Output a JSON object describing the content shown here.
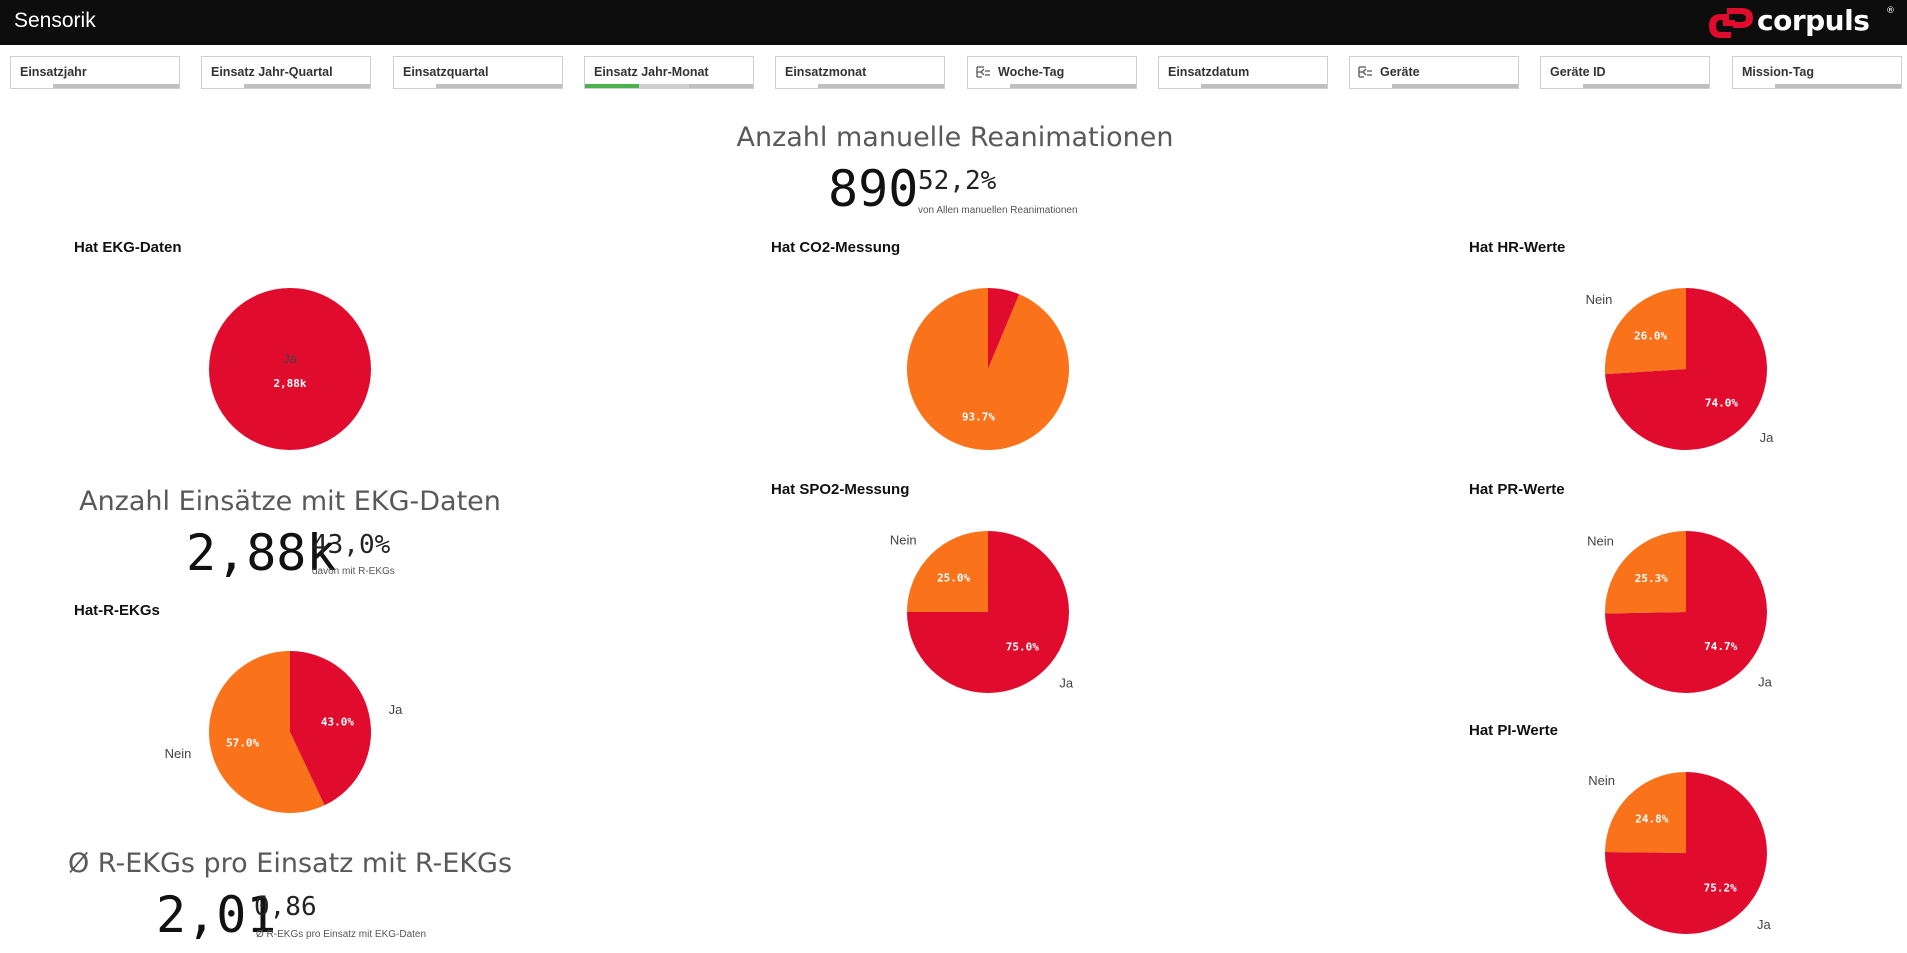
{
  "app": {
    "title": "Sensorik",
    "logo_text": "corpuls",
    "logo_mark": "®"
  },
  "colors": {
    "red": "#e00b2d",
    "orange": "#fa7219",
    "green": "#4caf50",
    "gray_bar": "#bfbfbf",
    "light_bar": "#d0d0d0"
  },
  "filters": [
    {
      "label": "Einsatzjahr",
      "icon": "",
      "selection": {
        "green": 0,
        "light": 0
      }
    },
    {
      "label": "Einsatz Jahr-Quartal",
      "icon": "",
      "selection": {
        "green": 0,
        "light": 0
      }
    },
    {
      "label": "Einsatzquartal",
      "icon": "",
      "selection": {
        "green": 0,
        "light": 0
      }
    },
    {
      "label": "Einsatz Jahr-Monat",
      "icon": "",
      "selection": {
        "green": 0.32,
        "light": 0.3
      }
    },
    {
      "label": "Einsatzmonat",
      "icon": "",
      "selection": {
        "green": 0,
        "light": 0
      }
    },
    {
      "label": "Woche-Tag",
      "icon": "hierarchy-icon",
      "selection": {
        "green": 0,
        "light": 0
      }
    },
    {
      "label": "Einsatzdatum",
      "icon": "",
      "selection": {
        "green": 0,
        "light": 0
      }
    },
    {
      "label": "Geräte",
      "icon": "hierarchy-icon",
      "selection": {
        "green": 0,
        "light": 0
      }
    },
    {
      "label": "Geräte ID",
      "icon": "",
      "selection": {
        "green": 0,
        "light": 0
      }
    },
    {
      "label": "Mission-Tag",
      "icon": "",
      "selection": {
        "green": 0,
        "light": 0
      }
    }
  ],
  "kpis": {
    "reanimationen": {
      "title": "Anzahl manuelle Reanimationen",
      "value": "890",
      "sub_value": "52,2%",
      "note": "von Allen manuellen Reanimationen"
    },
    "ekg_einsaetze": {
      "title": "Anzahl Einsätze mit EKG-Daten",
      "value": "2,88k",
      "sub_value": "43,0%",
      "note": "davon mit R-EKGs"
    },
    "r_ekgs": {
      "title": "Ø R-EKGs pro Einsatz mit R-EKGs",
      "value": "2,01",
      "sub_value": "0,86",
      "note": "Ø R-EKGs pro Einsatz mit EKG-Daten"
    }
  },
  "charts": {
    "hat_ekg": {
      "title": "Hat EKG-Daten"
    },
    "hat_r_ekgs": {
      "title": "Hat-R-EKGs"
    },
    "hat_co2": {
      "title": "Hat CO2-Messung"
    },
    "hat_spo2": {
      "title": "Hat SPO2-Messung"
    },
    "hat_hr": {
      "title": "Hat HR-Werte"
    },
    "hat_pr": {
      "title": "Hat PR-Werte"
    },
    "hat_pi": {
      "title": "Hat PI-Werte"
    }
  },
  "chart_data": [
    {
      "id": "hat_ekg",
      "type": "pie",
      "title": "Hat EKG-Daten",
      "slices": [
        {
          "label": "Ja",
          "value": 100,
          "display": "2,88k",
          "color": "#e00b2d"
        }
      ]
    },
    {
      "id": "hat_r_ekgs",
      "type": "pie",
      "title": "Hat-R-EKGs",
      "slices": [
        {
          "label": "Ja",
          "value": 43.0,
          "display": "43.0%",
          "color": "#e00b2d"
        },
        {
          "label": "Nein",
          "value": 57.0,
          "display": "57.0%",
          "color": "#fa7219"
        }
      ]
    },
    {
      "id": "hat_co2",
      "type": "pie",
      "title": "Hat CO2-Messung",
      "slices": [
        {
          "label": "",
          "value": 6.3,
          "display": "",
          "color": "#e00b2d"
        },
        {
          "label": "",
          "value": 93.7,
          "display": "93.7%",
          "color": "#fa7219"
        }
      ]
    },
    {
      "id": "hat_spo2",
      "type": "pie",
      "title": "Hat SPO2-Messung",
      "slices": [
        {
          "label": "Ja",
          "value": 75.0,
          "display": "75.0%",
          "color": "#e00b2d"
        },
        {
          "label": "Nein",
          "value": 25.0,
          "display": "25.0%",
          "color": "#fa7219"
        }
      ]
    },
    {
      "id": "hat_hr",
      "type": "pie",
      "title": "Hat HR-Werte",
      "slices": [
        {
          "label": "Ja",
          "value": 74.0,
          "display": "74.0%",
          "color": "#e00b2d"
        },
        {
          "label": "Nein",
          "value": 26.0,
          "display": "26.0%",
          "color": "#fa7219"
        }
      ]
    },
    {
      "id": "hat_pr",
      "type": "pie",
      "title": "Hat PR-Werte",
      "slices": [
        {
          "label": "Ja",
          "value": 74.7,
          "display": "74.7%",
          "color": "#e00b2d"
        },
        {
          "label": "Nein",
          "value": 25.3,
          "display": "25.3%",
          "color": "#fa7219"
        }
      ]
    },
    {
      "id": "hat_pi",
      "type": "pie",
      "title": "Hat PI-Werte",
      "slices": [
        {
          "label": "Ja",
          "value": 75.2,
          "display": "75.2%",
          "color": "#e00b2d"
        },
        {
          "label": "Nein",
          "value": 24.8,
          "display": "24.8%",
          "color": "#fa7219"
        }
      ]
    }
  ]
}
